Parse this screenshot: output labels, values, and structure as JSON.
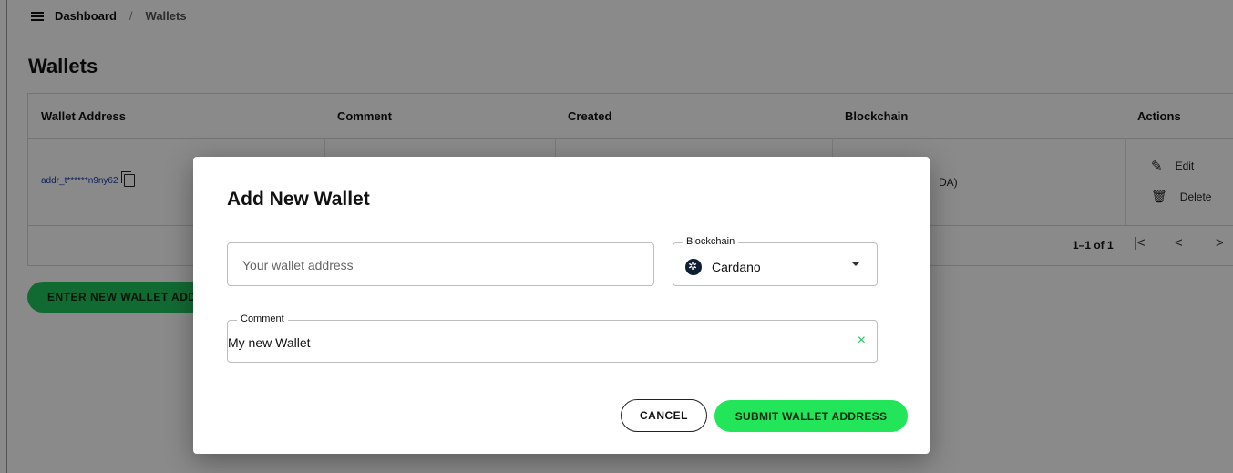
{
  "breadcrumb": {
    "root": "Dashboard",
    "separator": "/",
    "current": "Wallets"
  },
  "page": {
    "title": "Wallets"
  },
  "table": {
    "headers": [
      "Wallet Address",
      "Comment",
      "Created",
      "Blockchain",
      "Actions"
    ],
    "row": {
      "address": "addr_t******n9ny62",
      "blockchain_visible": "DA)"
    },
    "actions": {
      "edit": "Edit",
      "delete": "Delete"
    },
    "pagination": {
      "count": "1–1 of 1",
      "first": "|<",
      "prev": "<",
      "next": ">"
    }
  },
  "enter_button": "ENTER NEW WALLET ADD",
  "dialog": {
    "title": "Add New Wallet",
    "address_placeholder": "Your wallet address",
    "blockchain_label": "Blockchain",
    "blockchain_value": "Cardano",
    "comment_label": "Comment",
    "comment_value": "My new Wallet",
    "clear_icon": "×",
    "cancel": "CANCEL",
    "submit": "SUBMIT WALLET ADDRESS"
  },
  "colors": {
    "accent": "#22e55a",
    "link": "#1a3ea8"
  }
}
